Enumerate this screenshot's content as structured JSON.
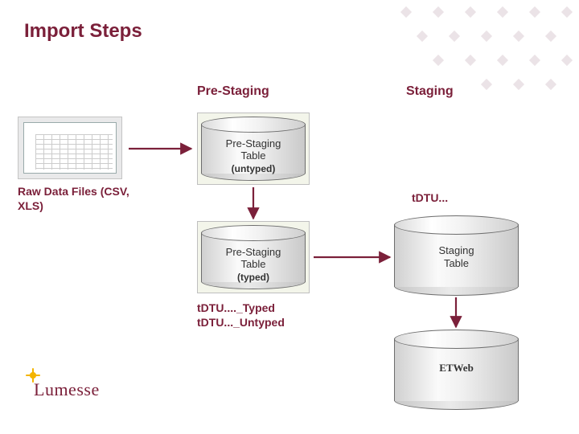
{
  "title": "Import Steps",
  "columns": {
    "prestaging": "Pre-Staging",
    "staging": "Staging"
  },
  "source": {
    "caption": "Raw Data Files (CSV, XLS)"
  },
  "cylinders": {
    "prestaging_untyped": {
      "line1": "Pre-Staging",
      "line2": "Table",
      "sub": "(untyped)"
    },
    "prestaging_typed": {
      "line1": "Pre-Staging",
      "line2": "Table",
      "sub": "(typed)"
    },
    "staging": {
      "line1": "Staging",
      "line2": "Table"
    },
    "etweb": {
      "line1": "ETWeb"
    }
  },
  "annotations": {
    "typed_names": "tDTU...._Typed\ntDTU..._Untyped",
    "staging_prefix": "tDTU..."
  },
  "logo": {
    "text": "Lumesse"
  },
  "arrowColor": "#7b203a"
}
